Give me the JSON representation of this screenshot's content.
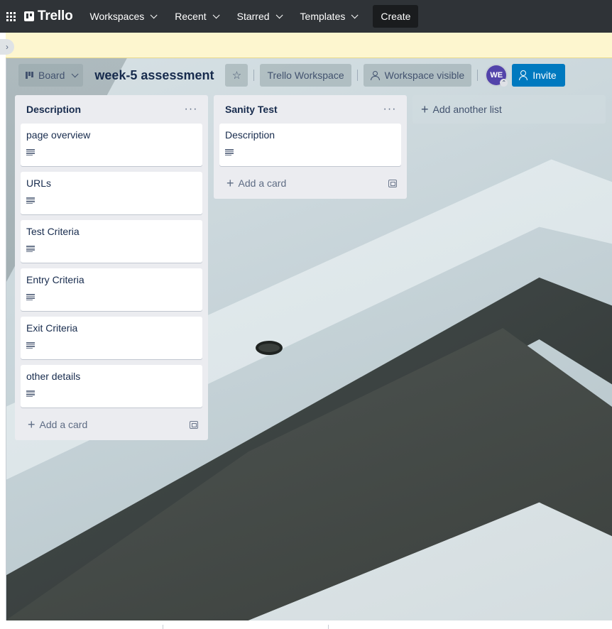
{
  "nav": {
    "logo": "Trello",
    "menus": [
      {
        "label": "Workspaces"
      },
      {
        "label": "Recent"
      },
      {
        "label": "Starred"
      },
      {
        "label": "Templates"
      }
    ],
    "create_label": "Create"
  },
  "board": {
    "view_label": "Board",
    "title": "week-5 assessment",
    "workspace_label": "Trello Workspace",
    "visibility_label": "Workspace visible",
    "avatar_initials": "WE",
    "invite_label": "Invite"
  },
  "lists": [
    {
      "title": "Description",
      "cards": [
        {
          "title": "page overview",
          "has_description": true
        },
        {
          "title": "URLs",
          "has_description": true
        },
        {
          "title": "Test Criteria",
          "has_description": true
        },
        {
          "title": "Entry Criteria",
          "has_description": true
        },
        {
          "title": "Exit Criteria",
          "has_description": true
        },
        {
          "title": "other details",
          "has_description": true
        }
      ],
      "add_card_label": "Add a card"
    },
    {
      "title": "Sanity Test",
      "cards": [
        {
          "title": "Description",
          "has_description": true
        }
      ],
      "add_card_label": "Add a card"
    }
  ],
  "add_list_label": "Add another list",
  "colors": {
    "nav_bg": "#2f3337",
    "banner_bg": "#fdf6cf",
    "invite_bg": "#0079bf",
    "avatar_bg": "#5243aa",
    "list_bg": "#ebecf0"
  },
  "icons": {
    "apps": "apps-grid-icon",
    "star": "star-icon",
    "visibility": "workspace-visible-icon",
    "invite": "add-person-icon",
    "list_menu": "more-horizontal-icon",
    "card_description": "description-lines-icon",
    "template": "card-template-icon"
  }
}
